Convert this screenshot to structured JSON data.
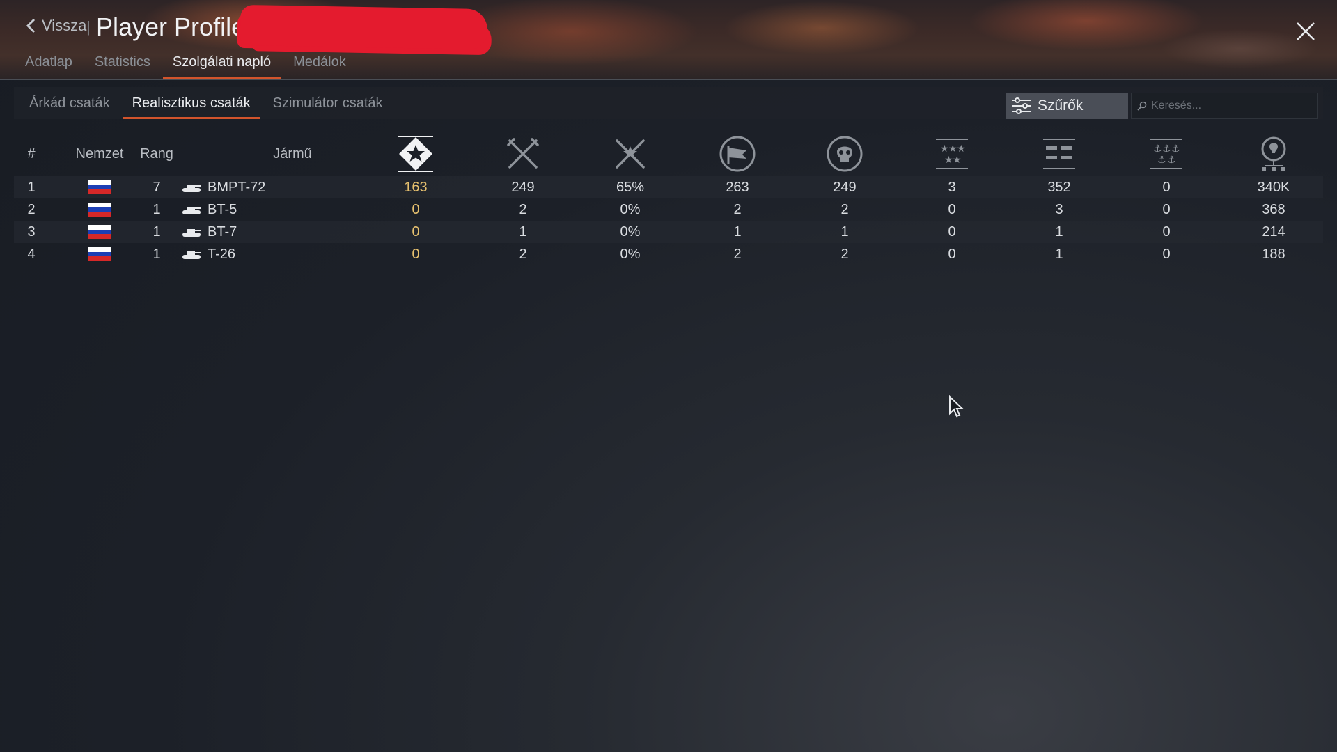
{
  "header": {
    "back_label": "Vissza",
    "separator": "|",
    "title": "Player Profile"
  },
  "main_tabs": [
    {
      "label": "Adatlap"
    },
    {
      "label": "Statistics"
    },
    {
      "label": "Szolgálati napló"
    },
    {
      "label": "Medálok"
    }
  ],
  "main_tab_active": 2,
  "sub_tabs": [
    {
      "label": "Árkád csaták"
    },
    {
      "label": "Realisztikus csaták"
    },
    {
      "label": "Szimulátor csaták"
    }
  ],
  "sub_tab_active": 1,
  "filters_label": "Szűrők",
  "search_placeholder": "Keresés...",
  "columns": {
    "num": "#",
    "nation": "Nemzet",
    "rank": "Rang",
    "vehicle": "Jármű",
    "stat_icons": [
      "activity-star-icon",
      "crossed-swords-icon",
      "win-rate-swords-icon",
      "flag-capture-icon",
      "skull-icon",
      "stars-rank-icon",
      "tanks-rank-icon",
      "anchors-rank-icon",
      "research-bulb-icon"
    ]
  },
  "rows": [
    {
      "num": "1",
      "nation_colors": [
        "#ffffff",
        "#1c3fb5",
        "#d62828"
      ],
      "rank": "7",
      "vehicle": "BMPT-72",
      "stats": [
        "163",
        "249",
        "65%",
        "263",
        "249",
        "3",
        "352",
        "0",
        "340K"
      ]
    },
    {
      "num": "2",
      "nation_colors": [
        "#ffffff",
        "#1c3fb5",
        "#d62828"
      ],
      "rank": "1",
      "vehicle": "BT-5",
      "stats": [
        "0",
        "2",
        "0%",
        "2",
        "2",
        "0",
        "3",
        "0",
        "368"
      ]
    },
    {
      "num": "3",
      "nation_colors": [
        "#ffffff",
        "#1c3fb5",
        "#d62828"
      ],
      "rank": "1",
      "vehicle": "BT-7",
      "stats": [
        "0",
        "1",
        "0%",
        "1",
        "1",
        "0",
        "1",
        "0",
        "214"
      ]
    },
    {
      "num": "4",
      "nation_colors": [
        "#ffffff",
        "#1c3fb5",
        "#d62828"
      ],
      "rank": "1",
      "vehicle": "T-26",
      "stats": [
        "0",
        "2",
        "0%",
        "2",
        "2",
        "0",
        "1",
        "0",
        "188"
      ]
    }
  ],
  "colors": {
    "accent": "#d2542c",
    "highlight_stat": "#e7c16f",
    "redaction": "#e41b2e"
  }
}
